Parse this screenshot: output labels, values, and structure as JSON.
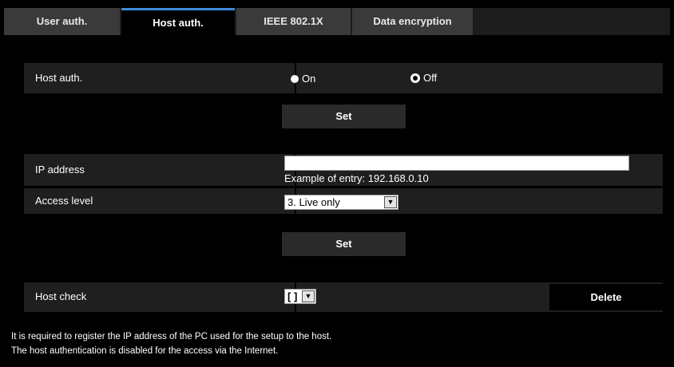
{
  "tabs": [
    {
      "label": "User auth."
    },
    {
      "label": "Host auth."
    },
    {
      "label": "IEEE 802.1X"
    },
    {
      "label": "Data encryption"
    }
  ],
  "host_auth": {
    "label": "Host auth.",
    "option_on": "On",
    "option_off": "Off",
    "selected": "Off",
    "set_label": "Set"
  },
  "ip_address": {
    "label": "IP address",
    "value": "",
    "hint": "Example of entry: 192.168.0.10"
  },
  "access_level": {
    "label": "Access level",
    "selected": "3. Live only",
    "set_label": "Set"
  },
  "host_check": {
    "label": "Host check",
    "selected": "[ ]",
    "delete_label": "Delete"
  },
  "notes": [
    "It is required to register the IP address of the PC used for the setup to the host.",
    "The host authentication is disabled for the access via the Internet."
  ],
  "colors": {
    "accent": "#3e8ad8",
    "row_bg": "#1f1f1f",
    "tab_bg": "#3a3a3a"
  }
}
